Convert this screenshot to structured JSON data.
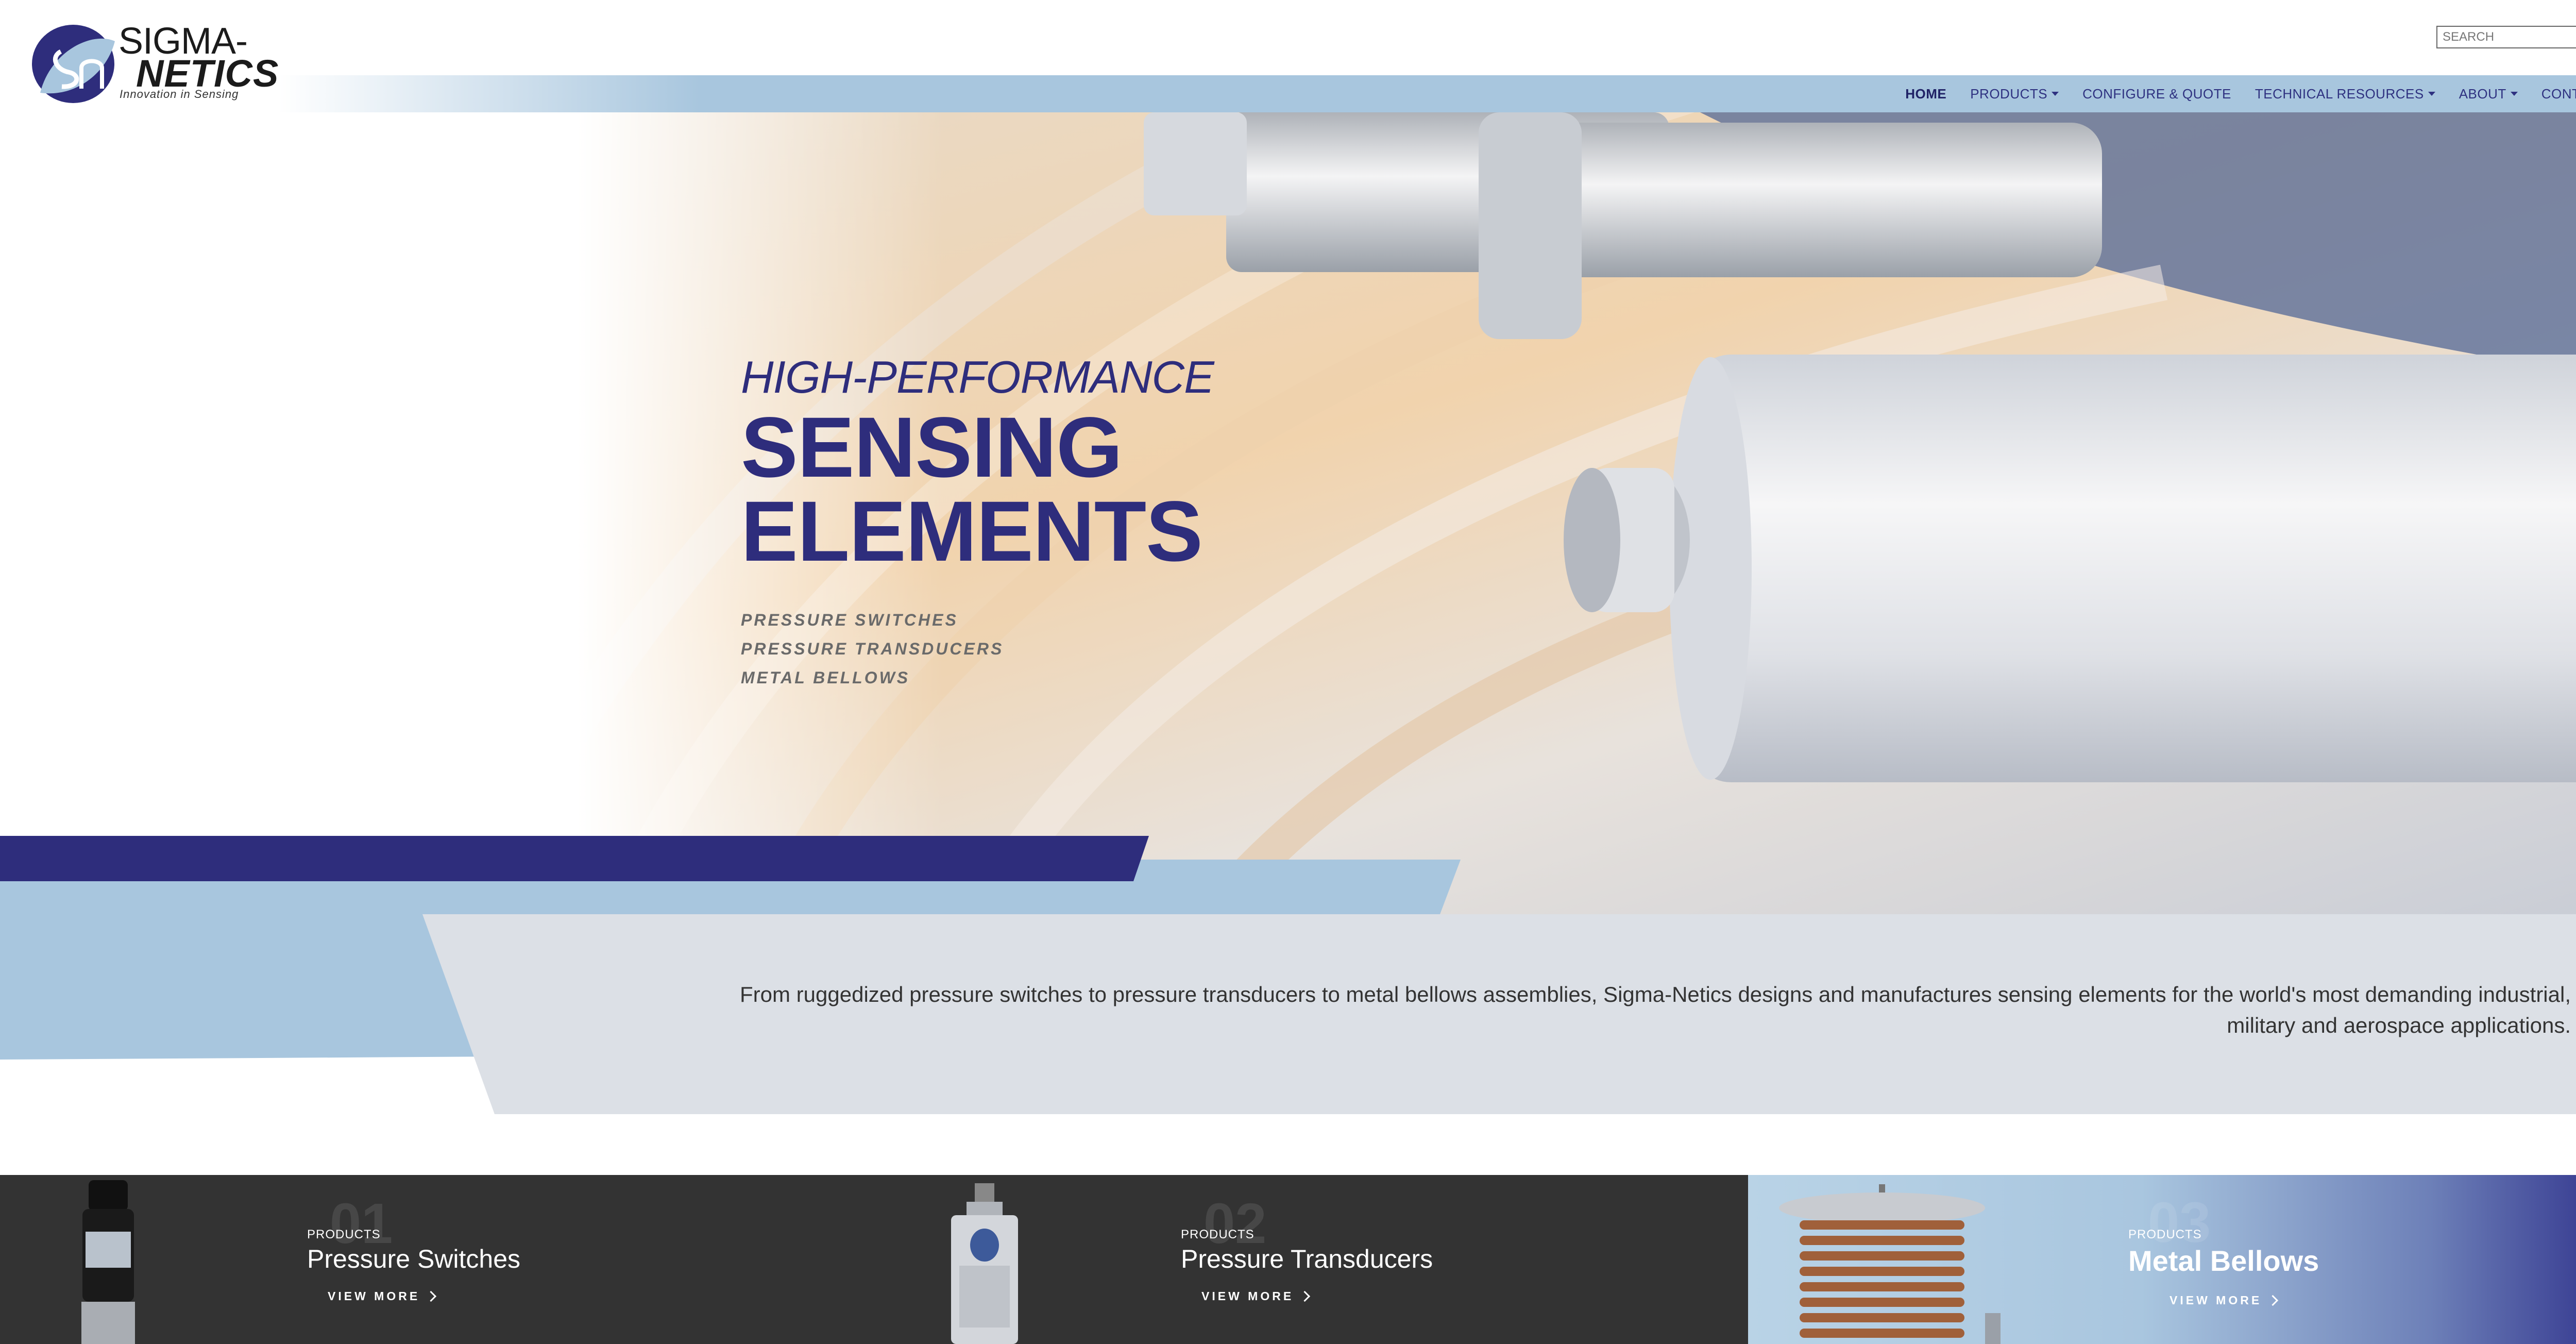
{
  "brand": {
    "name_line1": "SIGMA-",
    "name_line2": "NETICS",
    "tagline": "Innovation in Sensing",
    "logo_monogram": "Sn",
    "colors": {
      "navy": "#2e2d7c",
      "light_blue": "#a8c6de",
      "pale_gray": "#dce0e6",
      "dark_card": "#333333"
    }
  },
  "search": {
    "placeholder": "SEARCH",
    "icon": "search-icon"
  },
  "nav": {
    "items": [
      {
        "label": "HOME",
        "active": true,
        "dropdown": false
      },
      {
        "label": "PRODUCTS",
        "active": false,
        "dropdown": true
      },
      {
        "label": "CONFIGURE & QUOTE",
        "active": false,
        "dropdown": false
      },
      {
        "label": "TECHNICAL RESOURCES",
        "active": false,
        "dropdown": true
      },
      {
        "label": "ABOUT",
        "active": false,
        "dropdown": true
      },
      {
        "label": "CONTACT",
        "active": false,
        "dropdown": false
      }
    ]
  },
  "hero": {
    "kicker": "HIGH-PERFORMANCE",
    "title_line1": "SENSING",
    "title_line2": "ELEMENTS",
    "list": [
      "PRESSURE SWITCHES",
      "PRESSURE TRANSDUCERS",
      "METAL BELLOWS"
    ]
  },
  "intro": {
    "text": "From ruggedized pressure switches to pressure transducers to metal bellows assemblies, Sigma-Netics designs and manufactures sensing elements for the world's most demanding industrial, military and aerospace applications."
  },
  "cards": [
    {
      "number": "01",
      "kicker": "PRODUCTS",
      "title": "Pressure Switches",
      "more": "VIEW MORE"
    },
    {
      "number": "02",
      "kicker": "PRODUCTS",
      "title": "Pressure Transducers",
      "more": "VIEW MORE"
    },
    {
      "number": "03",
      "kicker": "PRODUCTS",
      "title": "Metal Bellows",
      "more": "VIEW MORE"
    }
  ]
}
